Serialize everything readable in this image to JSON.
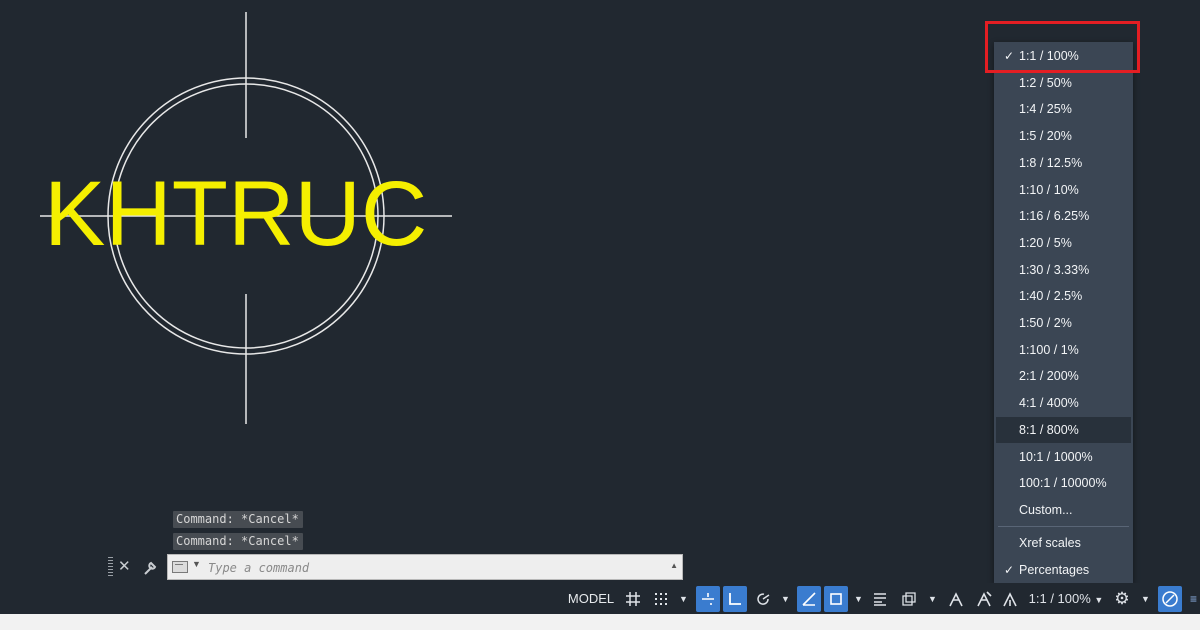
{
  "drawing": {
    "text": "KHTRUC"
  },
  "command_line": {
    "history": [
      "Command: *Cancel*",
      "Command: *Cancel*"
    ],
    "placeholder": "Type a command",
    "close_glyph": "✕",
    "customize_icon": "wrench-icon",
    "recent_icon": "command-line-icon"
  },
  "scale_menu": {
    "items": [
      {
        "label": "1:1 / 100%",
        "checked": true
      },
      {
        "label": "1:2 / 50%"
      },
      {
        "label": "1:4 / 25%"
      },
      {
        "label": "1:5 / 20%"
      },
      {
        "label": "1:8 / 12.5%"
      },
      {
        "label": "1:10 / 10%"
      },
      {
        "label": "1:16 / 6.25%"
      },
      {
        "label": "1:20 / 5%"
      },
      {
        "label": "1:30 / 3.33%"
      },
      {
        "label": "1:40 / 2.5%"
      },
      {
        "label": "1:50 / 2%"
      },
      {
        "label": "1:100 / 1%"
      },
      {
        "label": "2:1 / 200%"
      },
      {
        "label": "4:1 / 400%"
      },
      {
        "label": "8:1 / 800%",
        "hovered": true
      },
      {
        "label": "10:1 / 1000%"
      },
      {
        "label": "100:1 / 10000%"
      },
      {
        "label": "Custom..."
      }
    ],
    "extra_items": [
      {
        "label": "Xref scales"
      },
      {
        "label": "Percentages",
        "checked": true
      }
    ],
    "check_glyph": "✓",
    "highlight_color": "#e41e23",
    "background_color": "#3b4654"
  },
  "status_bar": {
    "model_label": "MODEL",
    "scale_label": "1:1 / 100%",
    "accent_color": "#3a7ccf",
    "icons": [
      "grid-icon",
      "snap-grid-icon",
      "infer-constraints-icon",
      "ortho-icon",
      "polar-tracking-icon",
      "isodraft-icon",
      "object-snap-icon",
      "lineweight-icon",
      "transparency-icon",
      "annotation-visibility-icon",
      "auto-scale-icon",
      "annotation-scale-icon",
      "settings-gear-icon",
      "isolate-objects-icon"
    ]
  },
  "colors": {
    "background": "#212830",
    "text_yellow": "#f5ef00",
    "geometry_white": "#e8e8e8"
  }
}
